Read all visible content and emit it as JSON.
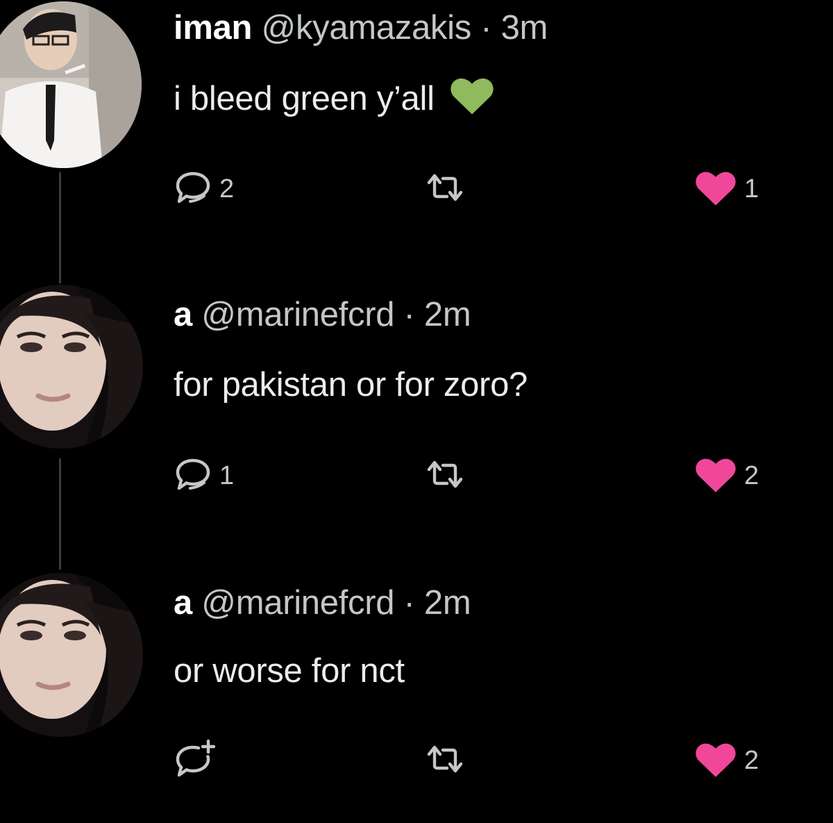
{
  "colors": {
    "background": "#000000",
    "text": "#e7e9ea",
    "muted": "#c4c7ca",
    "like_active": "#f0479a",
    "green_heart": "#8fba5e",
    "thread_line": "#3a3d41"
  },
  "tweets": [
    {
      "name": "iman",
      "handle": "@kyamazakis",
      "separator": "·",
      "time": "3m",
      "text": "i bleed green y’all",
      "emoji": "green-heart",
      "reply_count": "2",
      "retweet_count": "",
      "like_count": "1",
      "liked": true,
      "reply_icon": "reply-icon",
      "retweet_icon": "retweet-icon",
      "like_icon": "heart-icon"
    },
    {
      "name": "a",
      "handle": "@marinefcrd",
      "separator": "·",
      "time": "2m",
      "text": "for pakistan or for zoro?",
      "reply_count": "1",
      "retweet_count": "",
      "like_count": "2",
      "liked": true,
      "reply_icon": "reply-icon",
      "retweet_icon": "retweet-icon",
      "like_icon": "heart-icon"
    },
    {
      "name": "a",
      "handle": "@marinefcrd",
      "separator": "·",
      "time": "2m",
      "text": "or worse for nct",
      "reply_count": "",
      "retweet_count": "",
      "like_count": "2",
      "liked": true,
      "reply_icon": "reply-plus-icon",
      "retweet_icon": "retweet-icon",
      "like_icon": "heart-icon"
    }
  ]
}
